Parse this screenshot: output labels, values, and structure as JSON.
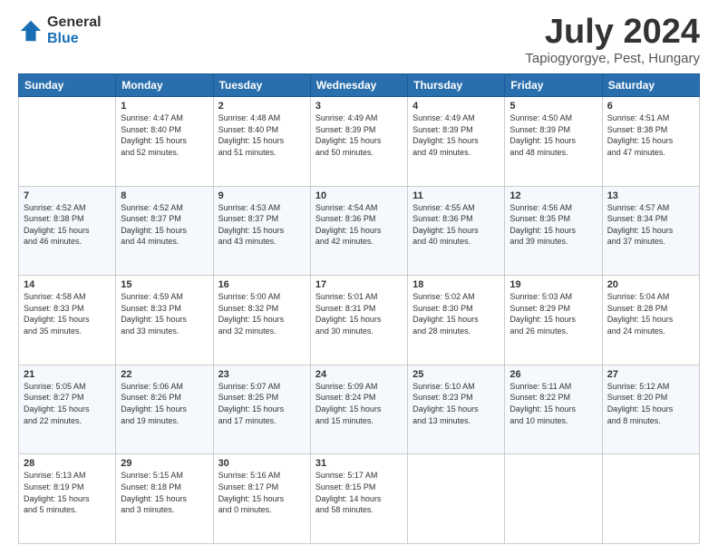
{
  "logo": {
    "general": "General",
    "blue": "Blue"
  },
  "title": "July 2024",
  "location": "Tapiogyorgye, Pest, Hungary",
  "weekdays": [
    "Sunday",
    "Monday",
    "Tuesday",
    "Wednesday",
    "Thursday",
    "Friday",
    "Saturday"
  ],
  "weeks": [
    [
      {
        "day": "",
        "info": ""
      },
      {
        "day": "1",
        "info": "Sunrise: 4:47 AM\nSunset: 8:40 PM\nDaylight: 15 hours\nand 52 minutes."
      },
      {
        "day": "2",
        "info": "Sunrise: 4:48 AM\nSunset: 8:40 PM\nDaylight: 15 hours\nand 51 minutes."
      },
      {
        "day": "3",
        "info": "Sunrise: 4:49 AM\nSunset: 8:39 PM\nDaylight: 15 hours\nand 50 minutes."
      },
      {
        "day": "4",
        "info": "Sunrise: 4:49 AM\nSunset: 8:39 PM\nDaylight: 15 hours\nand 49 minutes."
      },
      {
        "day": "5",
        "info": "Sunrise: 4:50 AM\nSunset: 8:39 PM\nDaylight: 15 hours\nand 48 minutes."
      },
      {
        "day": "6",
        "info": "Sunrise: 4:51 AM\nSunset: 8:38 PM\nDaylight: 15 hours\nand 47 minutes."
      }
    ],
    [
      {
        "day": "7",
        "info": "Sunrise: 4:52 AM\nSunset: 8:38 PM\nDaylight: 15 hours\nand 46 minutes."
      },
      {
        "day": "8",
        "info": "Sunrise: 4:52 AM\nSunset: 8:37 PM\nDaylight: 15 hours\nand 44 minutes."
      },
      {
        "day": "9",
        "info": "Sunrise: 4:53 AM\nSunset: 8:37 PM\nDaylight: 15 hours\nand 43 minutes."
      },
      {
        "day": "10",
        "info": "Sunrise: 4:54 AM\nSunset: 8:36 PM\nDaylight: 15 hours\nand 42 minutes."
      },
      {
        "day": "11",
        "info": "Sunrise: 4:55 AM\nSunset: 8:36 PM\nDaylight: 15 hours\nand 40 minutes."
      },
      {
        "day": "12",
        "info": "Sunrise: 4:56 AM\nSunset: 8:35 PM\nDaylight: 15 hours\nand 39 minutes."
      },
      {
        "day": "13",
        "info": "Sunrise: 4:57 AM\nSunset: 8:34 PM\nDaylight: 15 hours\nand 37 minutes."
      }
    ],
    [
      {
        "day": "14",
        "info": "Sunrise: 4:58 AM\nSunset: 8:33 PM\nDaylight: 15 hours\nand 35 minutes."
      },
      {
        "day": "15",
        "info": "Sunrise: 4:59 AM\nSunset: 8:33 PM\nDaylight: 15 hours\nand 33 minutes."
      },
      {
        "day": "16",
        "info": "Sunrise: 5:00 AM\nSunset: 8:32 PM\nDaylight: 15 hours\nand 32 minutes."
      },
      {
        "day": "17",
        "info": "Sunrise: 5:01 AM\nSunset: 8:31 PM\nDaylight: 15 hours\nand 30 minutes."
      },
      {
        "day": "18",
        "info": "Sunrise: 5:02 AM\nSunset: 8:30 PM\nDaylight: 15 hours\nand 28 minutes."
      },
      {
        "day": "19",
        "info": "Sunrise: 5:03 AM\nSunset: 8:29 PM\nDaylight: 15 hours\nand 26 minutes."
      },
      {
        "day": "20",
        "info": "Sunrise: 5:04 AM\nSunset: 8:28 PM\nDaylight: 15 hours\nand 24 minutes."
      }
    ],
    [
      {
        "day": "21",
        "info": "Sunrise: 5:05 AM\nSunset: 8:27 PM\nDaylight: 15 hours\nand 22 minutes."
      },
      {
        "day": "22",
        "info": "Sunrise: 5:06 AM\nSunset: 8:26 PM\nDaylight: 15 hours\nand 19 minutes."
      },
      {
        "day": "23",
        "info": "Sunrise: 5:07 AM\nSunset: 8:25 PM\nDaylight: 15 hours\nand 17 minutes."
      },
      {
        "day": "24",
        "info": "Sunrise: 5:09 AM\nSunset: 8:24 PM\nDaylight: 15 hours\nand 15 minutes."
      },
      {
        "day": "25",
        "info": "Sunrise: 5:10 AM\nSunset: 8:23 PM\nDaylight: 15 hours\nand 13 minutes."
      },
      {
        "day": "26",
        "info": "Sunrise: 5:11 AM\nSunset: 8:22 PM\nDaylight: 15 hours\nand 10 minutes."
      },
      {
        "day": "27",
        "info": "Sunrise: 5:12 AM\nSunset: 8:20 PM\nDaylight: 15 hours\nand 8 minutes."
      }
    ],
    [
      {
        "day": "28",
        "info": "Sunrise: 5:13 AM\nSunset: 8:19 PM\nDaylight: 15 hours\nand 5 minutes."
      },
      {
        "day": "29",
        "info": "Sunrise: 5:15 AM\nSunset: 8:18 PM\nDaylight: 15 hours\nand 3 minutes."
      },
      {
        "day": "30",
        "info": "Sunrise: 5:16 AM\nSunset: 8:17 PM\nDaylight: 15 hours\nand 0 minutes."
      },
      {
        "day": "31",
        "info": "Sunrise: 5:17 AM\nSunset: 8:15 PM\nDaylight: 14 hours\nand 58 minutes."
      },
      {
        "day": "",
        "info": ""
      },
      {
        "day": "",
        "info": ""
      },
      {
        "day": "",
        "info": ""
      }
    ]
  ]
}
